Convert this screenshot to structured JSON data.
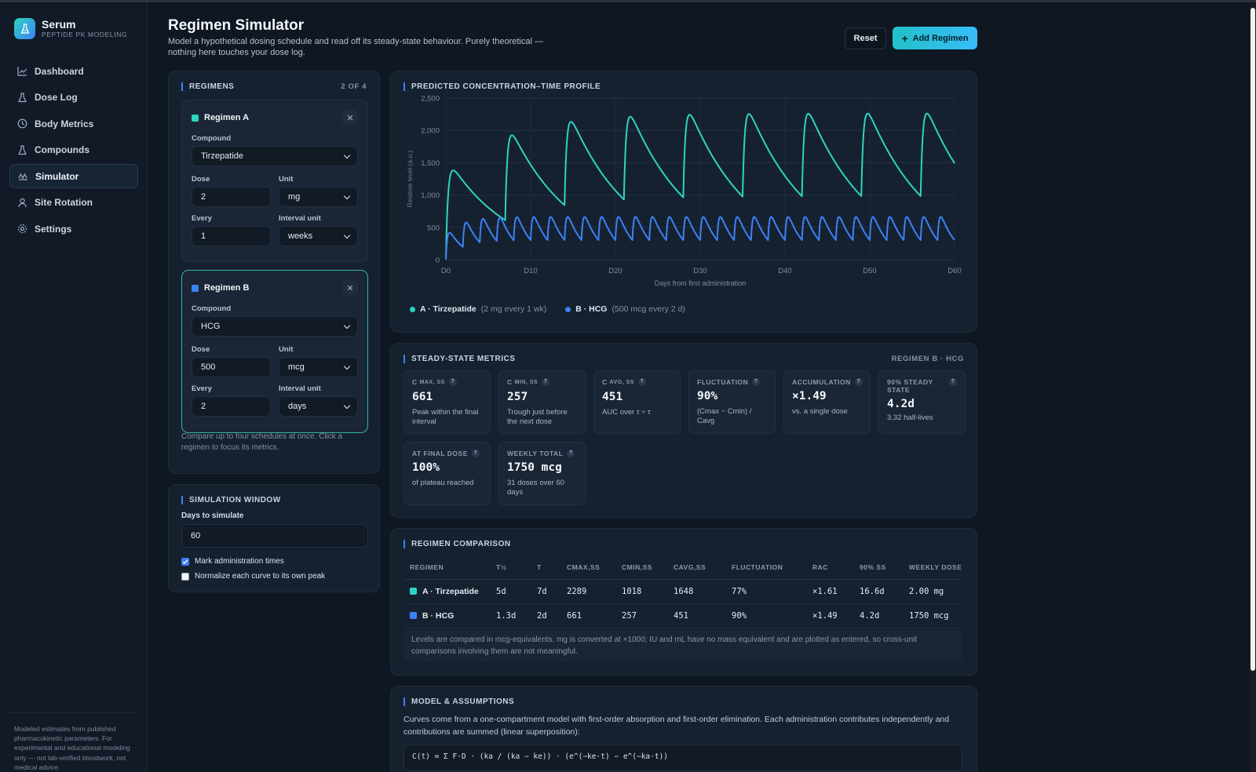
{
  "brand": {
    "name": "Serum",
    "subtitle": "PEPTIDE PK MODELING"
  },
  "nav": [
    {
      "label": "Dashboard",
      "icon": "chart-line-icon"
    },
    {
      "label": "Dose Log",
      "icon": "flask-icon"
    },
    {
      "label": "Body Metrics",
      "icon": "clock-icon"
    },
    {
      "label": "Compounds",
      "icon": "flask-icon"
    },
    {
      "label": "Simulator",
      "icon": "wave-chart-icon",
      "active": true
    },
    {
      "label": "Site Rotation",
      "icon": "person-icon"
    },
    {
      "label": "Settings",
      "icon": "gear-icon"
    }
  ],
  "sidebar_footer": "Modeled estimates from published pharmacokinetic parameters. For experimental and educational modeling only — not lab-verified bloodwork, not medical advice.",
  "header": {
    "title": "Regimen Simulator",
    "subtitle": "Model a hypothetical dosing schedule and read off its steady-state behaviour. Purely theoretical — nothing here touches your dose log.",
    "reset_label": "Reset",
    "add_label": "Add Regimen"
  },
  "regimens_panel": {
    "title": "REGIMENS",
    "count": "2 OF 4",
    "hint": "Compare up to four schedules at once. Click a regimen to focus its metrics.",
    "labels": {
      "compound": "Compound",
      "dose": "Dose",
      "unit": "Unit",
      "every": "Every",
      "interval_unit": "Interval unit"
    },
    "items": [
      {
        "name": "Regimen A",
        "color": "#2dd4bf",
        "compound": "Tirzepatide",
        "dose": "2",
        "unit": "mg",
        "every": "1",
        "interval_unit": "weeks"
      },
      {
        "name": "Regimen B",
        "color": "#3b82f6",
        "compound": "HCG",
        "dose": "500",
        "unit": "mcg",
        "every": "2",
        "interval_unit": "days"
      }
    ]
  },
  "sim_window": {
    "title": "SIMULATION WINDOW",
    "days_label": "Days to simulate",
    "days_value": "60",
    "mark_admin_label": "Mark administration times",
    "mark_admin_checked": true,
    "normalize_label": "Normalize each curve to its own peak",
    "normalize_checked": false
  },
  "chart_panel": {
    "title": "PREDICTED CONCENTRATION–TIME PROFILE"
  },
  "chart_data": {
    "type": "line",
    "title": "PREDICTED CONCENTRATION–TIME PROFILE",
    "xlabel": "Days from first administration",
    "ylabel": "Relative level (a.u.)",
    "xlim": [
      0,
      60
    ],
    "ylim": [
      0,
      2500
    ],
    "xticks": [
      0,
      10,
      20,
      30,
      40,
      50,
      60
    ],
    "xtick_labels": [
      "D0",
      "D10",
      "D20",
      "D30",
      "D40",
      "D50",
      "D60"
    ],
    "yticks": [
      0,
      500,
      1000,
      1500,
      2000,
      2500
    ],
    "ytick_labels": [
      "0",
      "500",
      "1,000",
      "1,500",
      "2,000",
      "2,500"
    ],
    "grid": true,
    "legend_position": "bottom-left",
    "series": [
      {
        "name": "A · Tirzepatide",
        "detail": "(2 mg every 1 wk)",
        "color": "#2dd4bf",
        "half_life_days": 5,
        "interval_days": 7,
        "dose": 2000,
        "ka": 4.0,
        "peak_scale": 2260
      },
      {
        "name": "B · HCG",
        "detail": "(500 mcg every 2 d)",
        "color": "#3b82f6",
        "half_life_days": 1.3,
        "interval_days": 2,
        "dose": 500,
        "ka": 6.0,
        "peak_scale": 661
      }
    ]
  },
  "metrics_panel": {
    "title": "STEADY-STATE METRICS",
    "focus": "REGIMEN B · HCG",
    "items": [
      {
        "label_main": "C",
        "label_sub": "MAX, SS",
        "value": "661",
        "sub": "Peak within the final interval"
      },
      {
        "label_main": "C",
        "label_sub": "MIN, SS",
        "value": "257",
        "sub": "Trough just before the next dose"
      },
      {
        "label_main": "C",
        "label_sub": "AVG, SS",
        "value": "451",
        "sub": "AUC over τ ÷ τ"
      },
      {
        "label_main": "FLUCTUATION",
        "label_sub": "",
        "value": "90%",
        "sub": "(Cmax − Cmin) / Cavg"
      },
      {
        "label_main": "ACCUMULATION",
        "label_sub": "",
        "value": "×1.49",
        "sub": "vs. a single dose"
      },
      {
        "label_main": "90% STEADY STATE",
        "label_sub": "",
        "value": "4.2d",
        "sub": "3.32 half-lives"
      },
      {
        "label_main": "AT FINAL DOSE",
        "label_sub": "",
        "value": "100%",
        "sub": "of plateau reached"
      },
      {
        "label_main": "WEEKLY TOTAL",
        "label_sub": "",
        "value": "1750 mcg",
        "sub": "31 doses over 60 days"
      }
    ]
  },
  "comparison": {
    "title": "REGIMEN COMPARISON",
    "columns": [
      "REGIMEN",
      "T½",
      "T",
      "CMAX,SS",
      "CMIN,SS",
      "CAVG,SS",
      "FLUCTUATION",
      "RAC",
      "90% SS",
      "WEEKLY DOSE"
    ],
    "rows": [
      {
        "color": "#2dd4bf",
        "name": "A · Tirzepatide",
        "cells": [
          "5d",
          "7d",
          "2289",
          "1018",
          "1648",
          "77%",
          "×1.61",
          "16.6d",
          "2.00 mg"
        ]
      },
      {
        "color": "#3b82f6",
        "name": "B · HCG",
        "cells": [
          "1.3d",
          "2d",
          "661",
          "257",
          "451",
          "90%",
          "×1.49",
          "4.2d",
          "1750 mcg"
        ]
      }
    ],
    "note": "Levels are compared in mcg-equivalents. mg is converted at ×1000; IU and mL have no mass equivalent and are plotted as entered, so cross-unit comparisons involving them are not meaningful."
  },
  "model": {
    "title": "MODEL & ASSUMPTIONS",
    "text": "Curves come from a one-compartment model with first-order absorption and first-order elimination. Each administration contributes independently and contributions are summed (linear superposition):",
    "formula": "C(t) = Σ F·D · (ka / (ka − ke)) · (e^(−ke·t) − e^(−ka·t))"
  }
}
